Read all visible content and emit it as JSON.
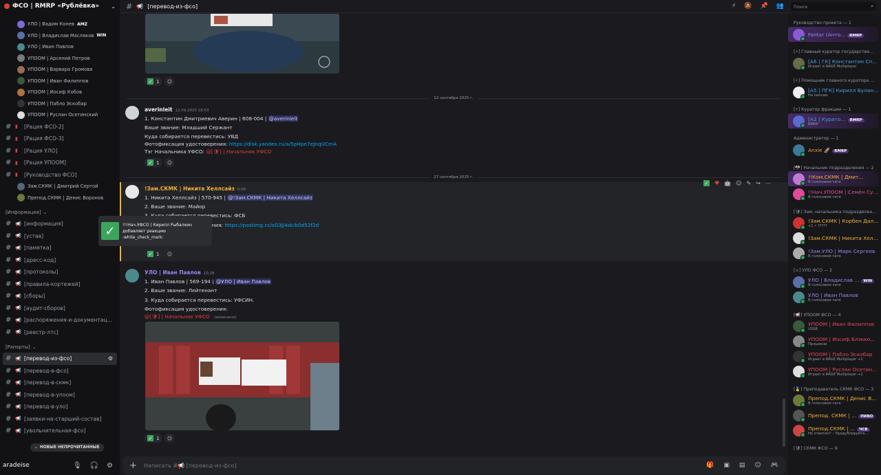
{
  "server": {
    "name": "ФСО | RMRP «Рублёвка»"
  },
  "voice_users": [
    {
      "name": "УЛО | Вадим Конев",
      "badge": "AMZ",
      "color": "#7b6cd9"
    },
    {
      "name": "УЛО | Владислав Масляков",
      "badge": "WIN",
      "color": "#5a6fa8"
    },
    {
      "name": "УЛО | Иван Павлов",
      "badge": "",
      "color": "#4b8a8c"
    },
    {
      "name": "УПООМ | Арсений Петров",
      "badge": "",
      "color": "#7a7a7a"
    },
    {
      "name": "УПООМ | Варвара Громова",
      "badge": "",
      "color": "#9a6a5a"
    },
    {
      "name": "УПООМ | Иван Филиппов",
      "badge": "",
      "color": "#3a5a3a"
    },
    {
      "name": "УПООМ | Иосиф Кобов",
      "badge": "",
      "color": "#b07040"
    },
    {
      "name": "УПООМ | Пабло Эскобар",
      "badge": "",
      "color": "#333333"
    },
    {
      "name": "УПООМ | Руслан Осетинский",
      "badge": "",
      "color": "#dddddd"
    }
  ],
  "voice_channels": [
    "[Рация ФСО-2]",
    "[Рация ФСО-3]",
    "[Рация УЛО]",
    "[Рация УПООМ]",
    "[Руководство ФСО]"
  ],
  "leaders_voice": [
    {
      "name": "Зам.СКМК | Дмитрий Сертой",
      "color": "#556677"
    },
    {
      "name": "Препод.СКМК | Денис Воронов",
      "color": "#6a7a3a"
    }
  ],
  "category_info": "[Информация]",
  "info_channels": [
    "[информация]",
    "[устав]",
    "[памятка]",
    "[дресс-код]",
    "[протоколы]",
    "[правила-кортежей]",
    "[сборы]",
    "[аудит-сборов]",
    "[распоряжения-и-документац...",
    "[реестр-лтс]"
  ],
  "category_reports": "[Рапорты]",
  "report_channels": [
    "[перевод-из-фсо]",
    "[перевод-в-фсо]",
    "[перевод-в-скмк]",
    "[перевод-в-упоом]",
    "[перевод-в-уло]",
    "[заявки-на-старший-состав]",
    "[увольнительная-фсо]"
  ],
  "unread_pill": "НОВЫЕ НЕПРОЧИТАННЫЕ",
  "user_panel": {
    "name": "aradeise"
  },
  "channel_title": "[перевод-из-фсо]",
  "search_placeholder": "Поиск",
  "dividers": [
    "12 сентября 2025 г.",
    "27 сентября 2025 г."
  ],
  "messages": [
    {
      "author": "averinleit",
      "time": "12.09.2025 18:53",
      "author_color": "#f2f3f5",
      "l1_prefix": "1. Константин Дмитриевич Аверин | 608-004 |",
      "l1_mention": "@averinleit",
      "l2": "Ваше звание: Младший Сержант",
      "l3": "Куда собирается перевестись: УВД",
      "l4_prefix": "Фотофиксация удостоверения:",
      "l4_link": "https://disk.yandex.ru/a/5pHpe7eJnqUCmA",
      "l5_prefix": "Тэг Начальника УФСО:",
      "l5_role": "@[🛡] | Начальник УФСО",
      "count": "1"
    },
    {
      "author": "!Зам.СКМК | Никита Хеллсайз",
      "time": "0:06",
      "author_color": "#f0b232",
      "l1_prefix": "1. Никита Хеллсайз | 570-945 |",
      "l1_mention": "@!Зам.СКМК | Никита Хеллсайз",
      "l2": "2. Ваше звание: Майор",
      "l3": "3. Куда собирается перевестись: ФСБ",
      "l4_prefix": "ерения:",
      "l4_link": "https://postimg.cc/sG3Jj4sk/b0d52f2d",
      "count": "1"
    },
    {
      "author": "УЛО | Иван Павлов",
      "time": "10:28",
      "author_color": "#9b84ec",
      "l1_prefix": "1. Иван Павлов | 569-194 |",
      "l1_mention": "@УЛО | Иван Павлов",
      "l2": "2. Ваше звание: Лейтенант",
      "l3": "3. Куда собирается перевестись: УФСИН.",
      "l4_prefix": "Фотофиксация удостоверения:",
      "l5_role": "@[🛡] | Начальник УФСО",
      "l5_suffix": "(изменено)",
      "count": "1"
    }
  ],
  "top_count": "1",
  "toast": {
    "line1": "!!!Нач.УФСО | Кирилл Рыбалкин",
    "line2": "добавляет реакцию",
    "line3": ":white_check_mark:"
  },
  "composer_placeholder": "Написать #📢 [перевод-из-фсо]",
  "members": [
    {
      "role": "Руководство проекта — 1"
    },
    {
      "name": "Fantar (Анто...",
      "status": "",
      "color": "#9b84ec",
      "tag": "RMRP",
      "boxed": true,
      "av": "#8a5ad0"
    },
    {
      "role": "[⚡] Главный куратор государстве..."
    },
    {
      "name": "[А6 | ГК] Константин Сп...",
      "status": "Играет в RAGE Multiplayer",
      "color": "#4a9fdc",
      "av": "#6a6a4a"
    },
    {
      "role": "[⚡] Помощник главного куратора ..."
    },
    {
      "name": "[А5 | ПГК] Кирилл Булан...",
      "status": "На пенсии",
      "color": "#4a9fdc",
      "av": "#eeeeee"
    },
    {
      "role": "[⚡] Куратор фракции — 1"
    },
    {
      "name": "[А2 | Курато...",
      "status": "RMRP",
      "color": "#4a9fdc",
      "tag": "RMRP",
      "boxed": true,
      "av": "#5a6ad0"
    },
    {
      "role": "Администратор — 1"
    },
    {
      "name": "Anxie 🚀",
      "status": "",
      "color": "#e8a23a",
      "tag": "RMRP",
      "av": "#3a7a9a"
    },
    {
      "role": "[🎌] Начальник подразделения — 2"
    },
    {
      "name": "!!Ком.СКМК | Дмит...",
      "status": "В голосовом чате",
      "color": "#f0b232",
      "boxed": true,
      "av": "#c07ad0"
    },
    {
      "name": "!!Нач.УПООМ | Семён Су...",
      "status": "В голосовом чате",
      "color": "#e04a9a",
      "av": "#e04a9a"
    },
    {
      "role": "[🛡] Зам. начальника подразделен..."
    },
    {
      "name": "!Зам.СКМК | Корбен Дал...",
      "status": "+1 • ?????",
      "color": "#f0b232",
      "av": "#cc3333"
    },
    {
      "name": "!Зам.СКМК | Никита Хел...",
      "status": "",
      "color": "#f0b232",
      "av": "#dddddd"
    },
    {
      "name": "!Зам.УЛО | Марк Сергеев",
      "status": "В голосовом чате",
      "color": "#9b84ec",
      "av": "#aaaaaa"
    },
    {
      "role": "[⚔] УЛО ФСО — 2"
    },
    {
      "name": "УЛО | Владислав ...",
      "status": "В голосовом чате",
      "color": "#9b84ec",
      "tag": "WIN",
      "av": "#5a6fa8"
    },
    {
      "name": "УЛО | Иван Павлов",
      "status": "В голосовом чате",
      "color": "#9b84ec",
      "av": "#4b8a8c"
    },
    {
      "role": "[📢] УПООМ ФСО — 4"
    },
    {
      "name": "УПООМ | Иван Филиппов",
      "status": "USSR",
      "color": "#e04a5a",
      "av": "#3a5a3a"
    },
    {
      "name": "УПООМ | Иосиф Блэкко...",
      "status": "Пельмени",
      "color": "#e04a5a",
      "av": "#888888"
    },
    {
      "name": "УПООМ | Пабло Эскобар",
      "status": "Играет в RAGE Multiplayer +1",
      "color": "#e04a5a",
      "av": "#333333"
    },
    {
      "name": "УПООМ | Руслан Осетин...",
      "status": "Играет в RAGE Multiplayer +1",
      "color": "#e04a5a",
      "av": "#dddddd"
    },
    {
      "role": "[🏅] Преподаватель СКМК ФСО — 3"
    },
    {
      "name": "Препод.СКМК | Денис В...",
      "status": "В голосовом чате",
      "color": "#f0b232",
      "av": "#6a7a3a"
    },
    {
      "name": "Препод. СКМК | ...",
      "status": "",
      "color": "#f0b232",
      "tag": "ПИВО",
      "av": "#555555"
    },
    {
      "name": "Препод.СКМК | ...",
      "status": "Не ответил? – Продублируйте...",
      "color": "#f0b232",
      "tag": "ЧСВ",
      "av": "#cc4444"
    },
    {
      "role": "[🛡] СКМК ФСО — 9"
    }
  ]
}
